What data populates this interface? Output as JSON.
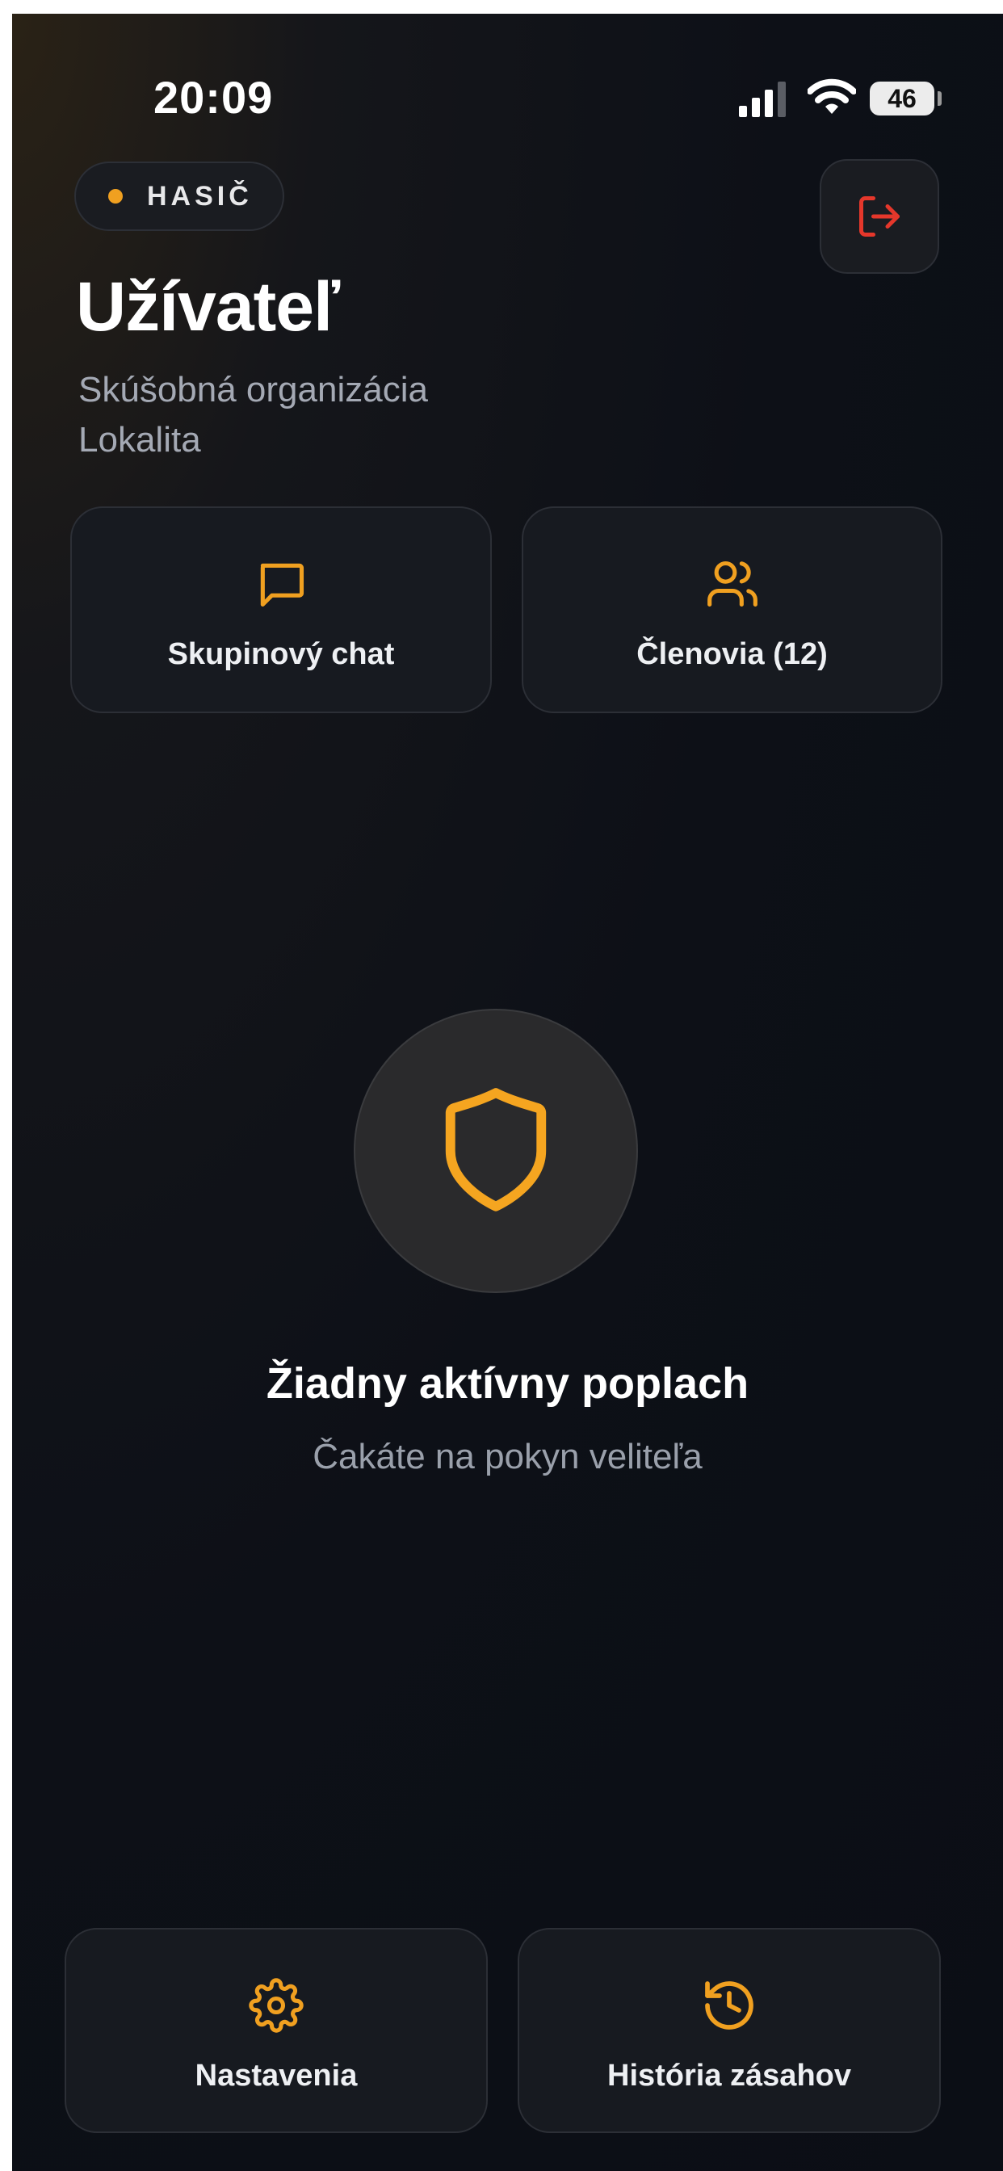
{
  "status_bar": {
    "time": "20:09",
    "battery": "46"
  },
  "header": {
    "role_badge": "HASIČ",
    "user_name": "Užívateľ",
    "organization": "Skúšobná organizácia",
    "location": "Lokalita"
  },
  "quick_actions": {
    "chat_label": "Skupinový chat",
    "members_label": "Členovia (12)"
  },
  "alarm_status": {
    "title": "Žiadny aktívny poplach",
    "subtitle": "Čakáte na pokyn veliteľa"
  },
  "bottom_actions": {
    "settings_label": "Nastavenia",
    "history_label": "História zásahov"
  },
  "colors": {
    "accent": "#f0a020",
    "danger": "#e5372b",
    "background": "#0d1017"
  },
  "icons": [
    "signal-icon",
    "wifi-icon",
    "battery-icon",
    "logout-icon",
    "chat-icon",
    "members-icon",
    "shield-icon",
    "gear-icon",
    "history-icon"
  ]
}
